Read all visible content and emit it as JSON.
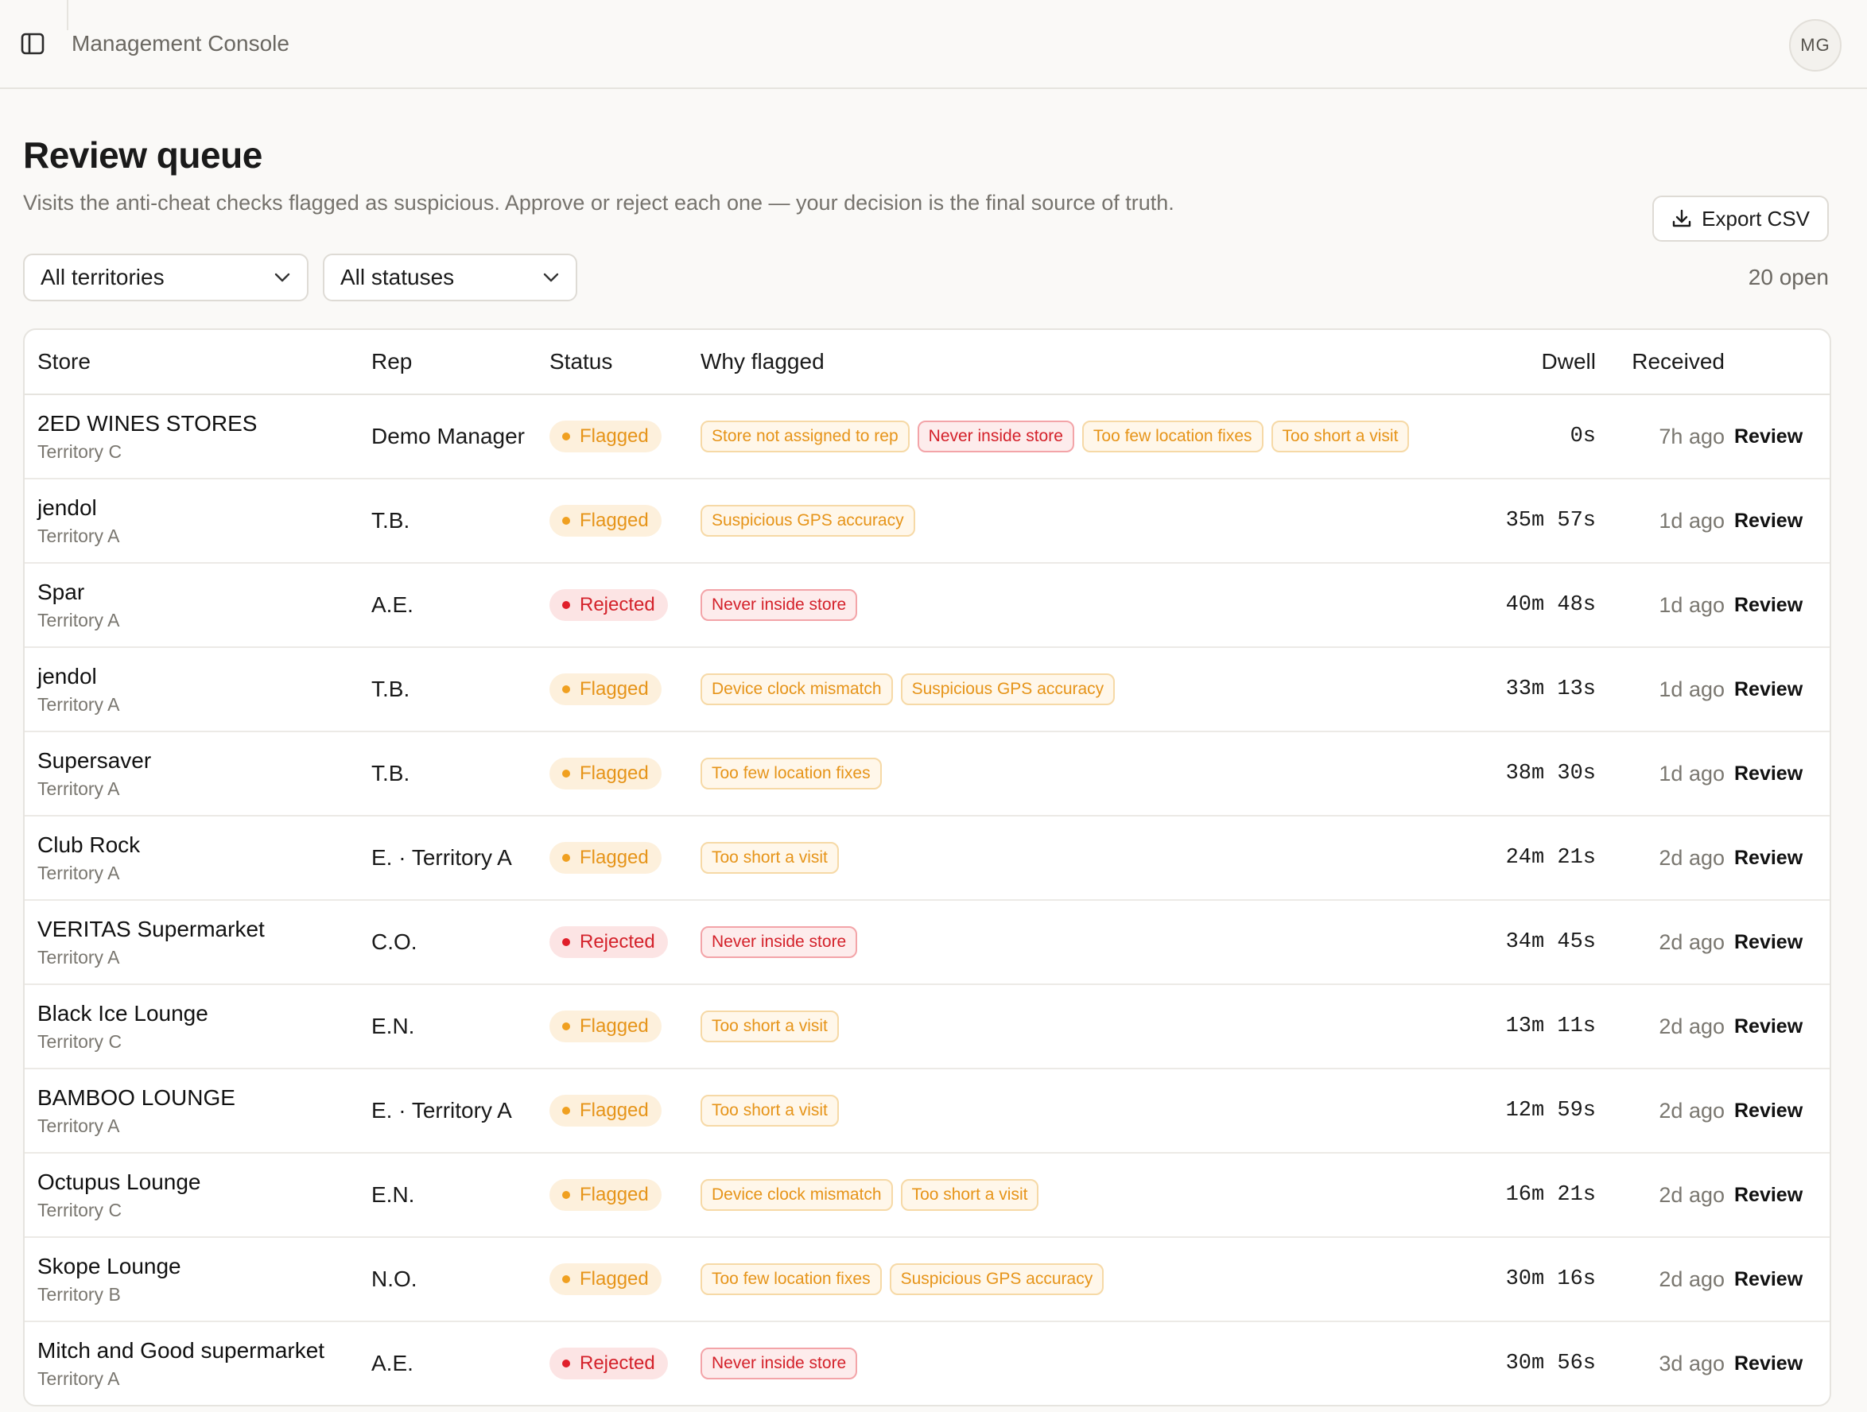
{
  "header": {
    "app_title": "Management Console",
    "avatar_initials": "MG"
  },
  "page": {
    "title": "Review queue",
    "subtitle": "Visits the anti-cheat checks flagged as suspicious. Approve or reject each one — your decision is the final source of truth.",
    "export_label": "Export CSV"
  },
  "filters": {
    "territory": "All territories",
    "status": "All statuses",
    "open_count": "20 open"
  },
  "columns": {
    "store": "Store",
    "rep": "Rep",
    "status": "Status",
    "why": "Why flagged",
    "dwell": "Dwell",
    "received": "Received"
  },
  "colors": {
    "flagged": "#e69419",
    "rejected": "#d4212a",
    "background": "#faf9f7"
  },
  "rows": [
    {
      "store": "2ED WINES STORES",
      "territory": "Territory C",
      "rep": "Demo Manager",
      "status": "Flagged",
      "reasons": [
        {
          "t": "Store not assigned to rep",
          "k": "warn"
        },
        {
          "t": "Never inside store",
          "k": "danger"
        },
        {
          "t": "Too few location fixes",
          "k": "warn"
        },
        {
          "t": "Too short a visit",
          "k": "warn"
        }
      ],
      "dwell": "0s",
      "received": "7h ago",
      "action": "Review"
    },
    {
      "store": "jendol",
      "territory": "Territory A",
      "rep": "T.B.",
      "status": "Flagged",
      "reasons": [
        {
          "t": "Suspicious GPS accuracy",
          "k": "warn"
        }
      ],
      "dwell": "35m 57s",
      "received": "1d ago",
      "action": "Review"
    },
    {
      "store": "Spar",
      "territory": "Territory A",
      "rep": "A.E.",
      "status": "Rejected",
      "reasons": [
        {
          "t": "Never inside store",
          "k": "danger"
        }
      ],
      "dwell": "40m 48s",
      "received": "1d ago",
      "action": "Review"
    },
    {
      "store": "jendol",
      "territory": "Territory A",
      "rep": "T.B.",
      "status": "Flagged",
      "reasons": [
        {
          "t": "Device clock mismatch",
          "k": "warn"
        },
        {
          "t": "Suspicious GPS accuracy",
          "k": "warn"
        }
      ],
      "dwell": "33m 13s",
      "received": "1d ago",
      "action": "Review"
    },
    {
      "store": "Supersaver",
      "territory": "Territory A",
      "rep": "T.B.",
      "status": "Flagged",
      "reasons": [
        {
          "t": "Too few location fixes",
          "k": "warn"
        }
      ],
      "dwell": "38m 30s",
      "received": "1d ago",
      "action": "Review"
    },
    {
      "store": "Club Rock",
      "territory": "Territory A",
      "rep": "E. · Territory A",
      "status": "Flagged",
      "reasons": [
        {
          "t": "Too short a visit",
          "k": "warn"
        }
      ],
      "dwell": "24m 21s",
      "received": "2d ago",
      "action": "Review"
    },
    {
      "store": "VERITAS Supermarket",
      "territory": "Territory A",
      "rep": "C.O.",
      "status": "Rejected",
      "reasons": [
        {
          "t": "Never inside store",
          "k": "danger"
        }
      ],
      "dwell": "34m 45s",
      "received": "2d ago",
      "action": "Review"
    },
    {
      "store": "Black Ice Lounge",
      "territory": "Territory C",
      "rep": "E.N.",
      "status": "Flagged",
      "reasons": [
        {
          "t": "Too short a visit",
          "k": "warn"
        }
      ],
      "dwell": "13m 11s",
      "received": "2d ago",
      "action": "Review"
    },
    {
      "store": "BAMBOO LOUNGE",
      "territory": "Territory A",
      "rep": "E. · Territory A",
      "status": "Flagged",
      "reasons": [
        {
          "t": "Too short a visit",
          "k": "warn"
        }
      ],
      "dwell": "12m 59s",
      "received": "2d ago",
      "action": "Review"
    },
    {
      "store": "Octupus Lounge",
      "territory": "Territory C",
      "rep": "E.N.",
      "status": "Flagged",
      "reasons": [
        {
          "t": "Device clock mismatch",
          "k": "warn"
        },
        {
          "t": "Too short a visit",
          "k": "warn"
        }
      ],
      "dwell": "16m 21s",
      "received": "2d ago",
      "action": "Review"
    },
    {
      "store": "Skope Lounge",
      "territory": "Territory B",
      "rep": "N.O.",
      "status": "Flagged",
      "reasons": [
        {
          "t": "Too few location fixes",
          "k": "warn"
        },
        {
          "t": "Suspicious GPS accuracy",
          "k": "warn"
        }
      ],
      "dwell": "30m 16s",
      "received": "2d ago",
      "action": "Review"
    },
    {
      "store": "Mitch and Good supermarket",
      "territory": "Territory A",
      "rep": "A.E.",
      "status": "Rejected",
      "reasons": [
        {
          "t": "Never inside store",
          "k": "danger"
        }
      ],
      "dwell": "30m 56s",
      "received": "3d ago",
      "action": "Review"
    }
  ]
}
